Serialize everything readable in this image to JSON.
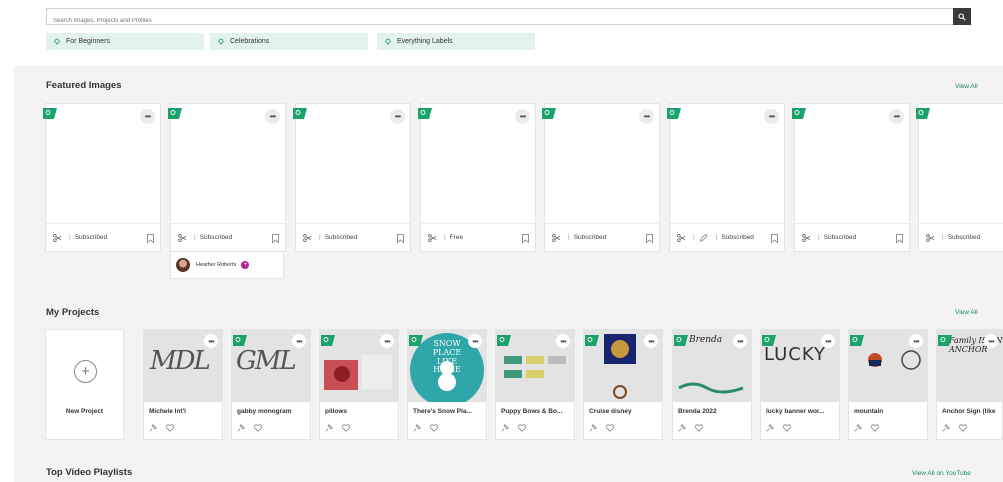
{
  "search": {
    "placeholder": "Search Images, Projects and Profiles"
  },
  "chips": [
    "For Beginners",
    "Celebrations",
    "Everything Labels"
  ],
  "featured": {
    "title": "Featured Images",
    "view_all": "View All",
    "cards": [
      {
        "status": "Subscribed",
        "edit_icon": false
      },
      {
        "status": "Subscribed",
        "edit_icon": false
      },
      {
        "status": "Subscribed",
        "edit_icon": false
      },
      {
        "status": "Free",
        "edit_icon": false
      },
      {
        "status": "Subscribed",
        "edit_icon": false
      },
      {
        "status": "Subscribed",
        "edit_icon": true
      },
      {
        "status": "Subscribed",
        "edit_icon": false
      },
      {
        "status": "Subscribed",
        "edit_icon": false
      }
    ],
    "owner": {
      "name": "Heather Roberts"
    }
  },
  "projects": {
    "title": "My Projects",
    "view_all": "View All",
    "new_project": "New Project",
    "items": [
      {
        "name": "Michele Int'l",
        "art": "MDL"
      },
      {
        "name": "gabby monogram",
        "art": "GML"
      },
      {
        "name": "pillows",
        "art": ""
      },
      {
        "name": "There's Snow Pla...",
        "art": "SNOW PLACE LIKE HOME"
      },
      {
        "name": "Puppy Bows & Bo...",
        "art": ""
      },
      {
        "name": "Cruise disney",
        "art": ""
      },
      {
        "name": "Brenda 2022",
        "art": "Brenda"
      },
      {
        "name": "lucky banner wor...",
        "art": "LUCKY"
      },
      {
        "name": "mountain",
        "art": ""
      },
      {
        "name": "Anchor Sign (like",
        "art": "Family IS AN ANCHOR"
      }
    ]
  },
  "playlists": {
    "title": "Top Video Playlists",
    "view_all": "View All on YouTube"
  },
  "colors": {
    "accent": "#1a8a5a",
    "chip_bg": "#e2f2ec",
    "page_bg": "#f3f3f3",
    "flag": "#1aa36a"
  }
}
